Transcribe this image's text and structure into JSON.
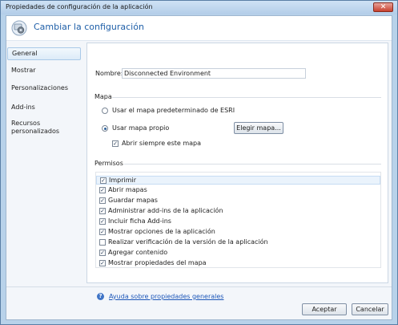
{
  "window": {
    "title": "Propiedades de configuración de la aplicación",
    "close_icon": "close-icon"
  },
  "header": {
    "title": "Cambiar la configuración",
    "icon": "settings-gear-icon"
  },
  "sidebar": {
    "items": [
      {
        "label": "General",
        "selected": true
      },
      {
        "label": "Mostrar",
        "selected": false
      },
      {
        "label": "Personalizaciones",
        "selected": false
      },
      {
        "label": "Add-ins",
        "selected": false
      },
      {
        "label": "Recursos personalizados",
        "selected": false
      }
    ]
  },
  "general": {
    "name_label": "Nombre:",
    "name_value": "Disconnected Environment",
    "map_section": "Mapa",
    "radio_default": "Usar el mapa predeterminado de ESRI",
    "radio_own": "Usar mapa propio",
    "selected_radio": "own",
    "choose_map_button": "Elegir mapa...",
    "always_open_label": "Abrir siempre este mapa",
    "always_open_checked": true,
    "permissions_section": "Permisos",
    "permissions": [
      {
        "label": "Imprimir",
        "checked": true
      },
      {
        "label": "Abrir mapas",
        "checked": true
      },
      {
        "label": "Guardar mapas",
        "checked": true
      },
      {
        "label": "Administrar add-ins de la aplicación",
        "checked": true
      },
      {
        "label": "Incluir ficha Add-ins",
        "checked": true
      },
      {
        "label": "Mostrar opciones de la aplicación",
        "checked": true
      },
      {
        "label": "Realizar verificación de la versión de la aplicación",
        "checked": false
      },
      {
        "label": "Agregar contenido",
        "checked": true
      },
      {
        "label": "Mostrar propiedades del mapa",
        "checked": true
      }
    ],
    "help_link": "Ayuda sobre propiedades generales"
  },
  "footer": {
    "accept": "Aceptar",
    "cancel": "Cancelar"
  },
  "colors": {
    "accent": "#1f5fa8",
    "link": "#1c56b8",
    "frame": "#b8d2ea"
  }
}
